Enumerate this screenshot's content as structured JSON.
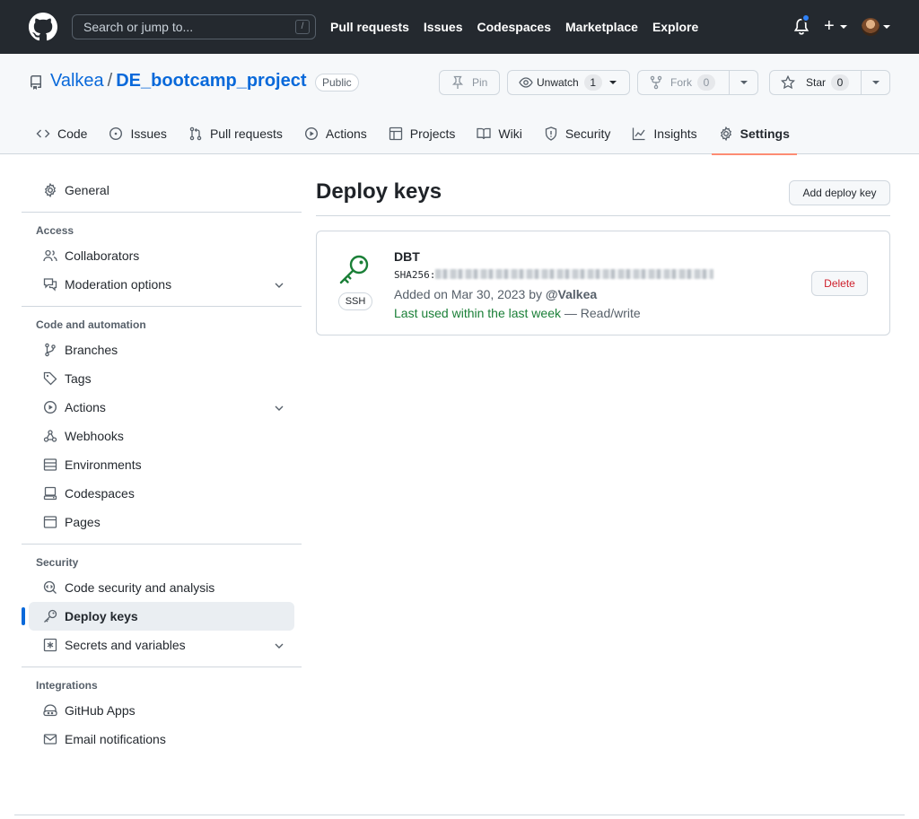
{
  "header": {
    "search_placeholder": "Search or jump to...",
    "search_shortcut": "/",
    "nav": [
      "Pull requests",
      "Issues",
      "Codespaces",
      "Marketplace",
      "Explore"
    ],
    "plus_label": "+"
  },
  "repo": {
    "owner": "Valkea",
    "separator": "/",
    "name": "DE_bootcamp_project",
    "visibility": "Public",
    "pin_label": "Pin",
    "unwatch_label": "Unwatch",
    "watch_count": "1",
    "fork_label": "Fork",
    "fork_count": "0",
    "star_label": "Star",
    "star_count": "0"
  },
  "tabs": [
    {
      "label": "Code",
      "icon": "code-icon"
    },
    {
      "label": "Issues",
      "icon": "issue-icon"
    },
    {
      "label": "Pull requests",
      "icon": "pull-request-icon"
    },
    {
      "label": "Actions",
      "icon": "play-icon"
    },
    {
      "label": "Projects",
      "icon": "table-icon"
    },
    {
      "label": "Wiki",
      "icon": "book-icon"
    },
    {
      "label": "Security",
      "icon": "shield-icon"
    },
    {
      "label": "Insights",
      "icon": "graph-icon"
    },
    {
      "label": "Settings",
      "icon": "gear-icon",
      "active": true
    }
  ],
  "sidebar": {
    "general": "General",
    "access_heading": "Access",
    "collaborators": "Collaborators",
    "moderation": "Moderation options",
    "code_heading": "Code and automation",
    "branches": "Branches",
    "tags": "Tags",
    "actions": "Actions",
    "webhooks": "Webhooks",
    "environments": "Environments",
    "codespaces": "Codespaces",
    "pages": "Pages",
    "security_heading": "Security",
    "code_security": "Code security and analysis",
    "deploy_keys": "Deploy keys",
    "secrets": "Secrets and variables",
    "integrations_heading": "Integrations",
    "github_apps": "GitHub Apps",
    "email_notifications": "Email notifications"
  },
  "main": {
    "title": "Deploy keys",
    "add_button": "Add deploy key",
    "key": {
      "name": "DBT",
      "type": "SSH",
      "fingerprint_prefix": "SHA256:",
      "added_text": "Added on Mar 30, 2023 by",
      "added_by": "@Valkea",
      "last_used": "Last used within the last week",
      "access": "— Read/write",
      "delete_label": "Delete"
    }
  },
  "colors": {
    "header_bg": "#24292f",
    "link": "#0969da",
    "active_tab_underline": "#fd8c73",
    "success": "#1a7f37",
    "danger": "#cf222e"
  }
}
